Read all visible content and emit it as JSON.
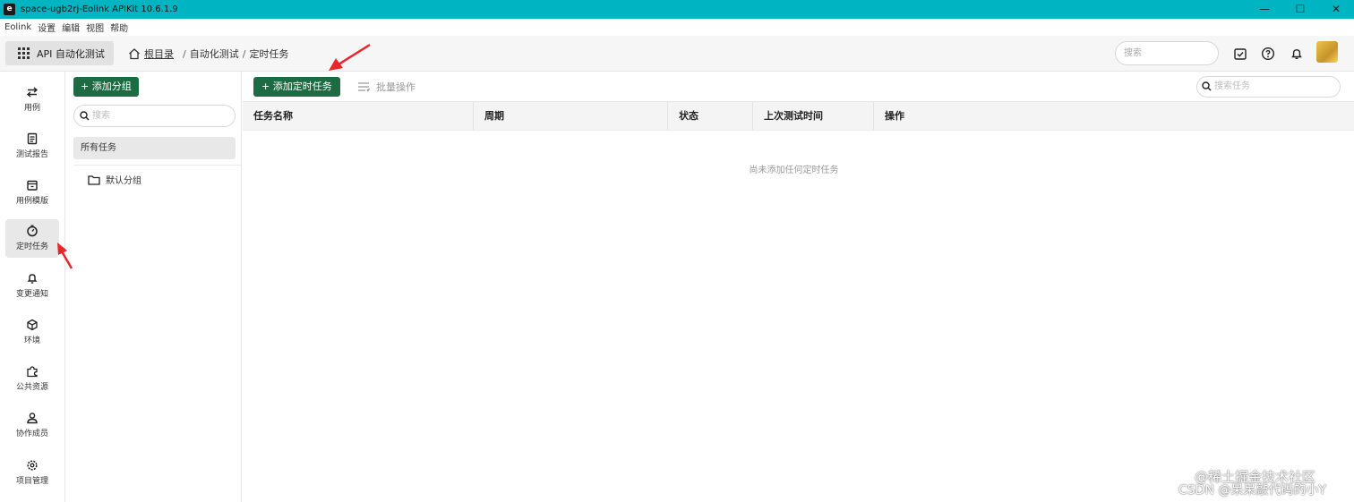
{
  "window": {
    "title": "space-ugb2rj-Eolink APIKit 10.6.1.9",
    "controls": {
      "minimize": "—",
      "maximize": "☐",
      "close": "✕"
    }
  },
  "menu": [
    "Eolink",
    "设置",
    "编辑",
    "视图",
    "帮助"
  ],
  "topbar": {
    "module_label": "API 自动化测试",
    "breadcrumb": {
      "root": "根目录",
      "level1": "自动化测试",
      "level2": "定时任务",
      "separator": "/"
    },
    "search_placeholder": "搜索"
  },
  "sidebar": {
    "items": [
      {
        "label": "用例",
        "icon": "swap-icon",
        "active": false
      },
      {
        "label": "测试报告",
        "icon": "report-icon",
        "active": false
      },
      {
        "label": "用例模版",
        "icon": "template-icon",
        "active": false
      },
      {
        "label": "定时任务",
        "icon": "clock-icon",
        "active": true
      },
      {
        "label": "变更通知",
        "icon": "bell-icon",
        "active": false
      },
      {
        "label": "环境",
        "icon": "cube-icon",
        "active": false
      },
      {
        "label": "公共资源",
        "icon": "puzzle-icon",
        "active": false
      },
      {
        "label": "协作成员",
        "icon": "user-icon",
        "active": false
      },
      {
        "label": "项目管理",
        "icon": "gear-icon",
        "active": false
      }
    ]
  },
  "groups": {
    "add_label": "+ 添加分组",
    "search_placeholder": "搜索",
    "all_tasks": "所有任务",
    "default_group": "默认分组"
  },
  "main": {
    "add_task_label": "+ 添加定时任务",
    "batch_label": "批量操作",
    "search_placeholder": "搜索任务",
    "columns": [
      "任务名称",
      "周期",
      "状态",
      "上次测试时间",
      "操作"
    ],
    "empty_text": "尚未添加任何定时任务"
  },
  "watermark": {
    "line1": "@稀土掘金技术社区",
    "line2": "CSDN @呆呆敲代码的小Y"
  },
  "colors": {
    "titlebar": "#00b4c1",
    "primary_button": "#1d6b43",
    "annotation_arrow": "#e8262c"
  }
}
